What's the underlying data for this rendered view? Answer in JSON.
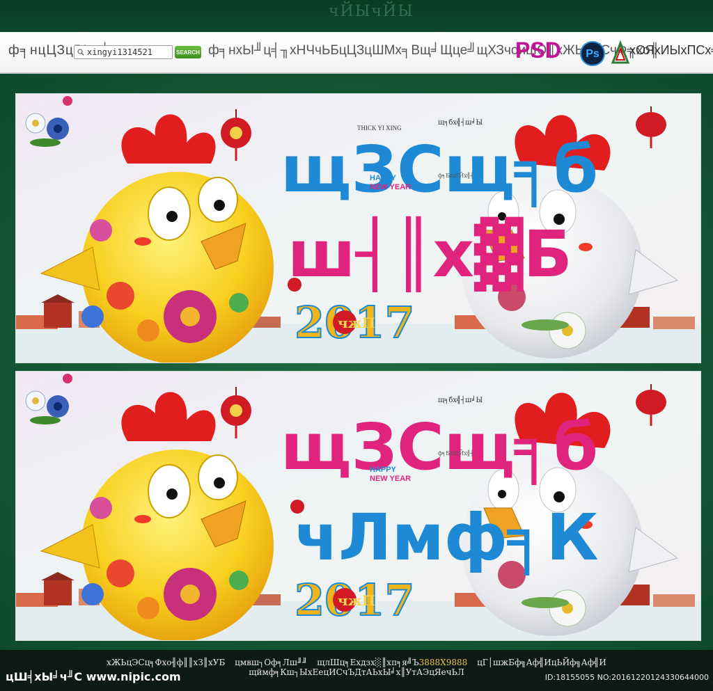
{
  "top": {
    "logo_text": "чЙЫчЙЫ"
  },
  "header": {
    "search_label": "ф╕нцЦЗцРЬч┤в",
    "search_value": "xingyi1314521",
    "search_button": "SEARCH",
    "place_text": "ф╕нхЫ╜ц╡╖хНЧчЬБцЦЗцШМх╕Вщ╛Щце╝щХЗчоицЮ╢хЖЬц░СчФ╗хо╢",
    "format_text": "PSD",
    "ps_label": "Ps",
    "original_text": "хОЯхИЫхПСх╕Г"
  },
  "panels": [
    {
      "title_top": "щЗСщ╕б",
      "title_bottom": "ш┤║х▓Б",
      "happy": "HAPPY",
      "new_year": "NEW YEAR",
      "year": "2017",
      "fu": "чжП",
      "side_note": "щ╕бх╣┤ш╛Ы",
      "small_caption": "THICK YI XING",
      "stamp_left": "ф╕БщЕЙх╣┤"
    },
    {
      "title_top": "щЗСщ╕б",
      "title_bottom": "чЛмф╕К",
      "happy": "HAPPY",
      "new_year": "NEW YEAR",
      "year": "2017",
      "fu": "чжП",
      "side_note": "щ╕бх╣┤ш╛Ы",
      "small_caption": "",
      "stamp_left": "ф╕БщЕЙх╣┤"
    }
  ],
  "footer": {
    "author": "хЖЬцЭСц╕Фхо╢ф║║хЗ║хУБ",
    "welcome": "цмвш┐Оф╕Лш╜╜",
    "size_label": "щлШц╕Ехдзх░║хп╕я╝Ъ",
    "size_value": "3888X9888",
    "want": "цГ│шжБф╗Аф╣ИцЬЙф╗Аф╣И",
    "enter": "щймф╕Кш┐ЫхЕецИСчЪДтАЬхЫ╛х║УтАЭцЯечЬЛ",
    "site": "цШ╡хЫ╛ч╜С www.nipic.com",
    "id_text": "ID:18155055 NO:20161220124330644000"
  },
  "colors": {
    "gold": "#f6c21a",
    "rooster_red": "#e11d1d",
    "blue": "#1e8ad6",
    "magenta": "#e0247e",
    "green": "#0f4a2e"
  }
}
